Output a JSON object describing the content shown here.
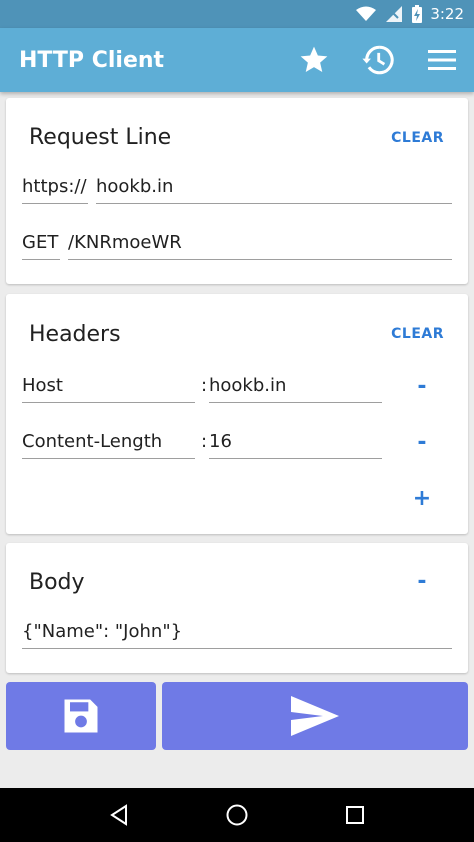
{
  "status_bar": {
    "time": "3:22"
  },
  "app_bar": {
    "title": "HTTP Client"
  },
  "request_line": {
    "title": "Request Line",
    "clear_label": "CLEAR",
    "scheme": "https://",
    "host": "hookb.in",
    "method": "GET",
    "path": "/KNRmoeWR"
  },
  "headers": {
    "title": "Headers",
    "clear_label": "CLEAR",
    "separator": ":",
    "remove_label": "-",
    "add_label": "+",
    "rows": [
      {
        "name": "Host",
        "value": "hookb.in"
      },
      {
        "name": "Content-Length",
        "value": "16"
      }
    ]
  },
  "body": {
    "title": "Body",
    "toggle_label": "-",
    "content": "{\"Name\": \"John\"}"
  },
  "colors": {
    "status_bar": "#4f93b8",
    "app_bar": "#5eaed6",
    "accent": "#2e7bd6",
    "action_button": "#6f7ae6"
  }
}
